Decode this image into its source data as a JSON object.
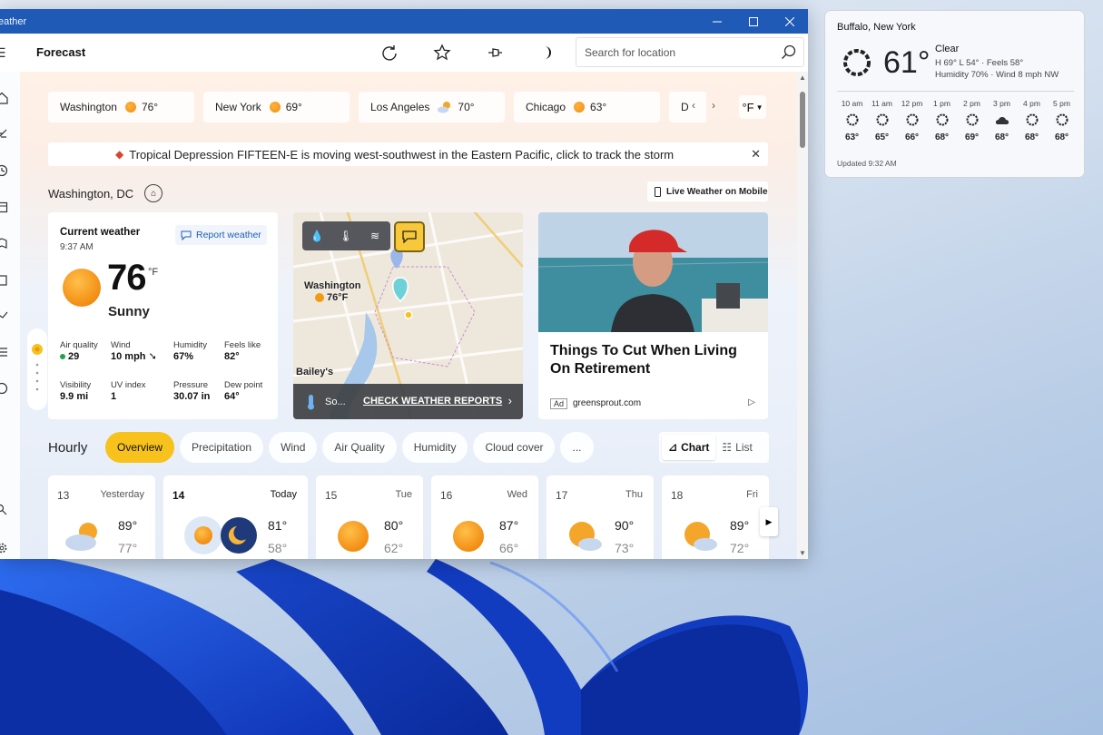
{
  "window": {
    "title": "eather",
    "page_title": "Forecast",
    "search_placeholder": "Search for location"
  },
  "cities": [
    {
      "name": "Washington",
      "temp": "76°"
    },
    {
      "name": "New York",
      "temp": "69°"
    },
    {
      "name": "Los Angeles",
      "temp": "70°"
    },
    {
      "name": "Chicago",
      "temp": "63°"
    },
    {
      "name": "D",
      "temp": ""
    }
  ],
  "unit": "°F",
  "alert": "Tropical Depression FIFTEEN-E is moving west-southwest in the Eastern Pacific, click to track the storm",
  "location": "Washington, DC",
  "mobile_label": "Live Weather on Mobile",
  "current": {
    "title": "Current weather",
    "time": "9:37 AM",
    "report_label": "Report weather",
    "temp": "76",
    "unit": "°F",
    "condition": "Sunny",
    "metrics": {
      "air_quality_label": "Air quality",
      "air_quality": "29",
      "wind_label": "Wind",
      "wind": "10 mph",
      "humidity_label": "Humidity",
      "humidity": "67%",
      "feels_label": "Feels like",
      "feels": "82°",
      "visibility_label": "Visibility",
      "visibility": "9.9 mi",
      "uv_label": "UV index",
      "uv": "1",
      "pressure_label": "Pressure",
      "pressure": "30.07 in",
      "dew_label": "Dew point",
      "dew": "64°"
    }
  },
  "map": {
    "city_label": "Washington",
    "city_temp": "76°F",
    "bottom_label": "Bailey's",
    "cta_prefix": "So...",
    "cta": "CHECK WEATHER REPORTS"
  },
  "ad": {
    "headline": "Things To Cut When Living On Retirement",
    "tag": "Ad",
    "source": "greensprout.com"
  },
  "hourly": {
    "title": "Hourly",
    "tabs": [
      "Overview",
      "Precipitation",
      "Wind",
      "Air Quality",
      "Humidity",
      "Cloud cover",
      "..."
    ],
    "chart_label": "Chart",
    "list_label": "List"
  },
  "days": [
    {
      "num": "13",
      "label": "Yesterday",
      "hi": "89°",
      "lo": "77°"
    },
    {
      "num": "14",
      "label": "Today",
      "hi": "81°",
      "lo": "58°"
    },
    {
      "num": "15",
      "label": "Tue",
      "hi": "80°",
      "lo": "62°"
    },
    {
      "num": "16",
      "label": "Wed",
      "hi": "87°",
      "lo": "66°"
    },
    {
      "num": "17",
      "label": "Thu",
      "hi": "90°",
      "lo": "73°"
    },
    {
      "num": "18",
      "label": "Fri",
      "hi": "89°",
      "lo": "72°"
    }
  ],
  "widget": {
    "location": "Buffalo, New York",
    "temp": "61°",
    "condition": "Clear",
    "hilo": "H 69°  L 54°  ·  Feels 58°",
    "humidity_wind": "Humidity 70%  ·  Wind 8 mph NW",
    "hours": [
      {
        "time": "10 am",
        "temp": "63°"
      },
      {
        "time": "11 am",
        "temp": "65°"
      },
      {
        "time": "12 pm",
        "temp": "66°"
      },
      {
        "time": "1 pm",
        "temp": "68°"
      },
      {
        "time": "2 pm",
        "temp": "69°"
      },
      {
        "time": "3 pm",
        "temp": "68°"
      },
      {
        "time": "4 pm",
        "temp": "68°"
      },
      {
        "time": "5 pm",
        "temp": "68°"
      }
    ],
    "updated": "Updated 9:32 AM"
  }
}
